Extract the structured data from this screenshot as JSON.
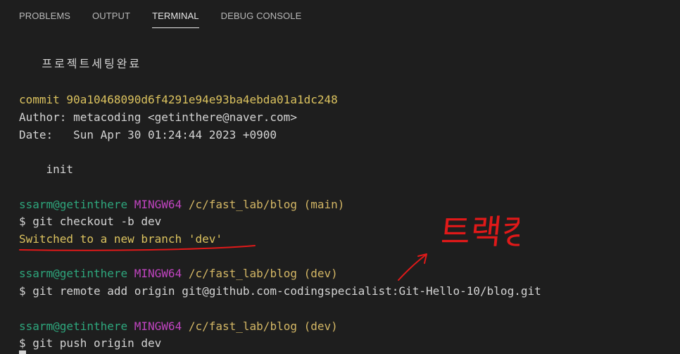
{
  "tabs": [
    {
      "label": "PROBLEMS"
    },
    {
      "label": "OUTPUT"
    },
    {
      "label": "TERMINAL"
    },
    {
      "label": "DEBUG CONSOLE"
    }
  ],
  "terminal": {
    "msg_korean": "    프로젝트세팅완료",
    "commit_line": "commit 90a10468090d6f4291e94e93ba4ebda01a1dc248",
    "author_line": "Author: metacoding <getinthere@naver.com>",
    "date_line": "Date:   Sun Apr 30 01:24:44 2023 +0900",
    "init_line": "    init",
    "prompt1": {
      "user": "ssarm@getinthere",
      "env": "MINGW64",
      "path": "/c/fast_lab/blog",
      "branch": "(main)"
    },
    "cmd1": "$ git checkout -b dev",
    "out1": "Switched to a new branch 'dev'",
    "prompt2": {
      "user": "ssarm@getinthere",
      "env": "MINGW64",
      "path": "/c/fast_lab/blog",
      "branch": "(dev)"
    },
    "cmd2": "$ git remote add origin git@github.com-codingspecialist:Git-Hello-10/blog.git",
    "prompt3": {
      "user": "ssarm@getinthere",
      "env": "MINGW64",
      "path": "/c/fast_lab/blog",
      "branch": "(dev)"
    },
    "cmd3": "$ git push origin dev"
  },
  "annotation": {
    "handwritten_text": "트랙킹",
    "color": "#e01919"
  },
  "colors": {
    "background": "#1e1e1e",
    "commit_yellow": "#dcc35f",
    "prompt_green": "#2ea77d",
    "prompt_magenta": "#c044c0",
    "prompt_path": "#d4b765"
  }
}
